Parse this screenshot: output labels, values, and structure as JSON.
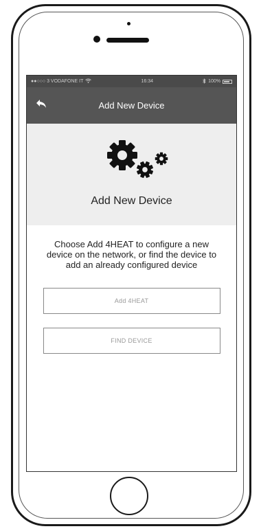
{
  "status_bar": {
    "carrier": "●●○○○ 3 VODAFONE IT",
    "time": "16:34",
    "battery_level": "100%"
  },
  "nav": {
    "title": "Add New Device"
  },
  "hero": {
    "title": "Add New Device"
  },
  "main": {
    "description": "Choose Add 4HEAT to configure a new device on the network, or find the device to add an already configured device",
    "add_button_label": "Add 4HEAT",
    "find_button_label": "FIND DEVICE"
  },
  "icons": {
    "back": "back-arrow-icon",
    "hero": "gears-icon",
    "wifi": "wifi-icon",
    "bluetooth": "bluetooth-icon",
    "battery": "battery-icon"
  },
  "colors": {
    "nav_background": "#555555",
    "hero_background": "#eeeeee",
    "button_border": "#888888"
  }
}
